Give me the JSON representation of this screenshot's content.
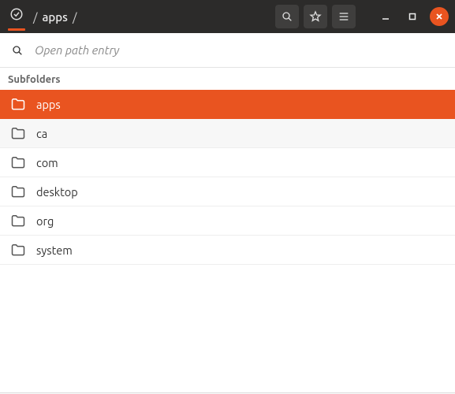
{
  "breadcrumb": {
    "sep1": "/",
    "item": "apps",
    "sep2": "/"
  },
  "search": {
    "placeholder": "Open path entry"
  },
  "section_header": "Subfolders",
  "folders": {
    "f0": "apps",
    "f1": "ca",
    "f2": "com",
    "f3": "desktop",
    "f4": "org",
    "f5": "system"
  },
  "colors": {
    "accent": "#e95420",
    "titlebar": "#2c2b2a"
  }
}
